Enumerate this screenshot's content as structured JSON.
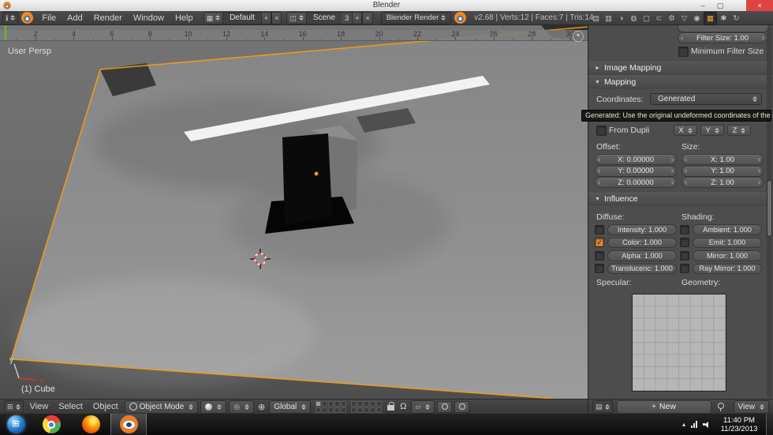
{
  "titlebar": {
    "title": "Blender"
  },
  "menubar": {
    "menus": [
      "File",
      "Add",
      "Render",
      "Window",
      "Help"
    ],
    "layout_value": "Default",
    "scene_value": "Scene",
    "scene_users": "3",
    "engine_value": "Blender Render",
    "stats": "v2.68 | Verts:12 | Faces:7 | Tris:14",
    "property_tabs": [
      {
        "name": "render",
        "glyph": "▤",
        "active": false
      },
      {
        "name": "render-layers",
        "glyph": "▥",
        "active": false
      },
      {
        "name": "scene",
        "glyph": "◑",
        "active": false
      },
      {
        "name": "world",
        "glyph": "◍",
        "active": false
      },
      {
        "name": "object",
        "glyph": "▢",
        "active": false
      },
      {
        "name": "constraints",
        "glyph": "⊂",
        "active": false
      },
      {
        "name": "modifiers",
        "glyph": "⚙",
        "active": false
      },
      {
        "name": "object-data",
        "glyph": "▽",
        "active": false
      },
      {
        "name": "material",
        "glyph": "◉",
        "active": false
      },
      {
        "name": "texture",
        "glyph": "▦",
        "active": true
      },
      {
        "name": "particles",
        "glyph": "✱",
        "active": false
      },
      {
        "name": "physics",
        "glyph": "↻",
        "active": false
      }
    ]
  },
  "viewport": {
    "ruler_numbers": [
      "2",
      "4",
      "6",
      "8",
      "10",
      "12",
      "14",
      "16",
      "18",
      "20",
      "22",
      "24",
      "26",
      "28",
      "30"
    ],
    "view_label": "User Persp",
    "object_label": "(1) Cube",
    "axis_x": "x",
    "axis_y": "y",
    "header": {
      "menus": [
        "View",
        "Select",
        "Object"
      ],
      "mode_value": "Object Mode",
      "orientation_value": "Global"
    }
  },
  "properties": {
    "filter_size": "Filter Size: 1.00",
    "min_filter_label": "Minimum Filter Size",
    "image_mapping_title": "Image Mapping",
    "mapping_title": "Mapping",
    "coordinates_label": "Coordinates:",
    "coordinates_value": "Generated",
    "tooltip": "Generated: Use the original undeformed coordinates of the object",
    "from_dupli_label": "From Dupli",
    "axis_buttons": [
      "X",
      "Y",
      "Z"
    ],
    "offset_label": "Offset:",
    "size_label": "Size:",
    "offset_fields": [
      "X: 0.00000",
      "Y: 0.00000",
      "Z: 0.00000"
    ],
    "size_fields": [
      "X: 1.00",
      "Y: 1.00",
      "Z: 1.00"
    ],
    "influence_title": "Influence",
    "diffuse_label": "Diffuse:",
    "shading_label": "Shading:",
    "diffuse_items": [
      {
        "label": "Intensity: 1.000",
        "checked": false
      },
      {
        "label": "Color: 1.000",
        "checked": true
      },
      {
        "label": "Alpha: 1.000",
        "checked": false
      },
      {
        "label": "Translucenc: 1.000",
        "checked": false
      }
    ],
    "shading_items": [
      {
        "label": "Ambient: 1.000",
        "checked": false
      },
      {
        "label": "Emit: 1.000",
        "checked": false
      },
      {
        "label": "Mirror: 1.000",
        "checked": false
      },
      {
        "label": "Ray Mirror: 1.000",
        "checked": false
      }
    ],
    "specular_label": "Specular:",
    "geometry_label": "Geometry:",
    "footer": {
      "new_label": "New",
      "view_label": "View"
    }
  },
  "taskbar": {
    "time": "11:40 PM",
    "date": "11/23/2013"
  },
  "colors": {
    "selection_outline": "#f49d12",
    "checked_checkbox": "#d9862c",
    "playhead_green": "#64bb33",
    "close_button_red": "#e04343"
  },
  "icons": {
    "check": "✓",
    "close": "×",
    "minimize": "–",
    "maximize": "▢",
    "plus": "+",
    "collapsed_arrow": "►",
    "expanded_arrow": "▼",
    "left_arrow": "‹",
    "right_arrow": "›",
    "info_editor": "ℹ",
    "viewport_editor": "⊞",
    "properties_editor": "▤",
    "browse_layout": "▦",
    "browse_scene": "◫",
    "pivot": "◎",
    "manipulator": "⊕",
    "magnet": "Ω",
    "snap_element": "▱",
    "tray_expand": "▴",
    "start_flag": "⊞"
  }
}
